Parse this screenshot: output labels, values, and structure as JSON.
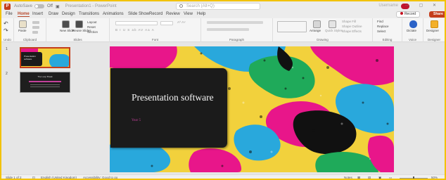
{
  "titlebar": {
    "app_logo": "P",
    "autosave_label": "AutoSave",
    "autosave_state": "Off",
    "doc_title": "Presentation1 - PowerPoint",
    "search_placeholder": "Search (Alt+Q)",
    "user_name": "Username",
    "window_controls": "— ▢ ✕"
  },
  "menu": {
    "tabs": [
      "File",
      "Home",
      "Insert",
      "Draw",
      "Design",
      "Transitions",
      "Animations",
      "Slide Show",
      "Record",
      "Review",
      "View",
      "Help"
    ],
    "active_tab": "Home",
    "record_label": "Record",
    "share_label": "Share"
  },
  "ribbon": {
    "undo_group": "Undo",
    "clipboard_group": "Clipboard",
    "paste_label": "Paste",
    "slides_group": "Slides",
    "new_slide_label": "New Slide",
    "reuse_slides_label": "Reuse Slides",
    "layout_label": "Layout",
    "reset_label": "Reset",
    "section_label": "Section",
    "font_group": "Font",
    "font_buttons": "B  I  U  S  ab  AV  Aa  A",
    "paragraph_group": "Paragraph",
    "drawing_group": "Drawing",
    "arrange_label": "Arrange",
    "quick_styles_label": "Quick Styles",
    "shape_fill_label": "Shape Fill",
    "shape_outline_label": "Shape Outline",
    "shape_effects_label": "Shape Effects",
    "editing_group": "Editing",
    "find_label": "Find",
    "replace_label": "Replace",
    "select_label": "Select",
    "voice_group": "Voice",
    "dictate_label": "Dictate",
    "designer_group": "Designer",
    "designer_label": "Designer"
  },
  "thumbnails": [
    {
      "number": "1",
      "title": "Presentation software",
      "selected": true
    },
    {
      "number": "2",
      "title": "The Loop Break",
      "selected": false
    }
  ],
  "slide": {
    "title": "Presentation software",
    "subtitle": "Year 5"
  },
  "statusbar": {
    "slide_info": "Slide 1 of 2",
    "language": "English (United Kingdom)",
    "accessibility": "Accessibility: Good to go",
    "notes_label": "Notes",
    "zoom": "50%"
  },
  "colors": {
    "accent": "#b7472a",
    "share": "#c43e1c",
    "slide_yellow": "#f2d13c",
    "slide_magenta": "#e8168a",
    "slide_blue": "#29a8dc",
    "slide_green": "#1faa5a",
    "slide_black": "#111111"
  }
}
